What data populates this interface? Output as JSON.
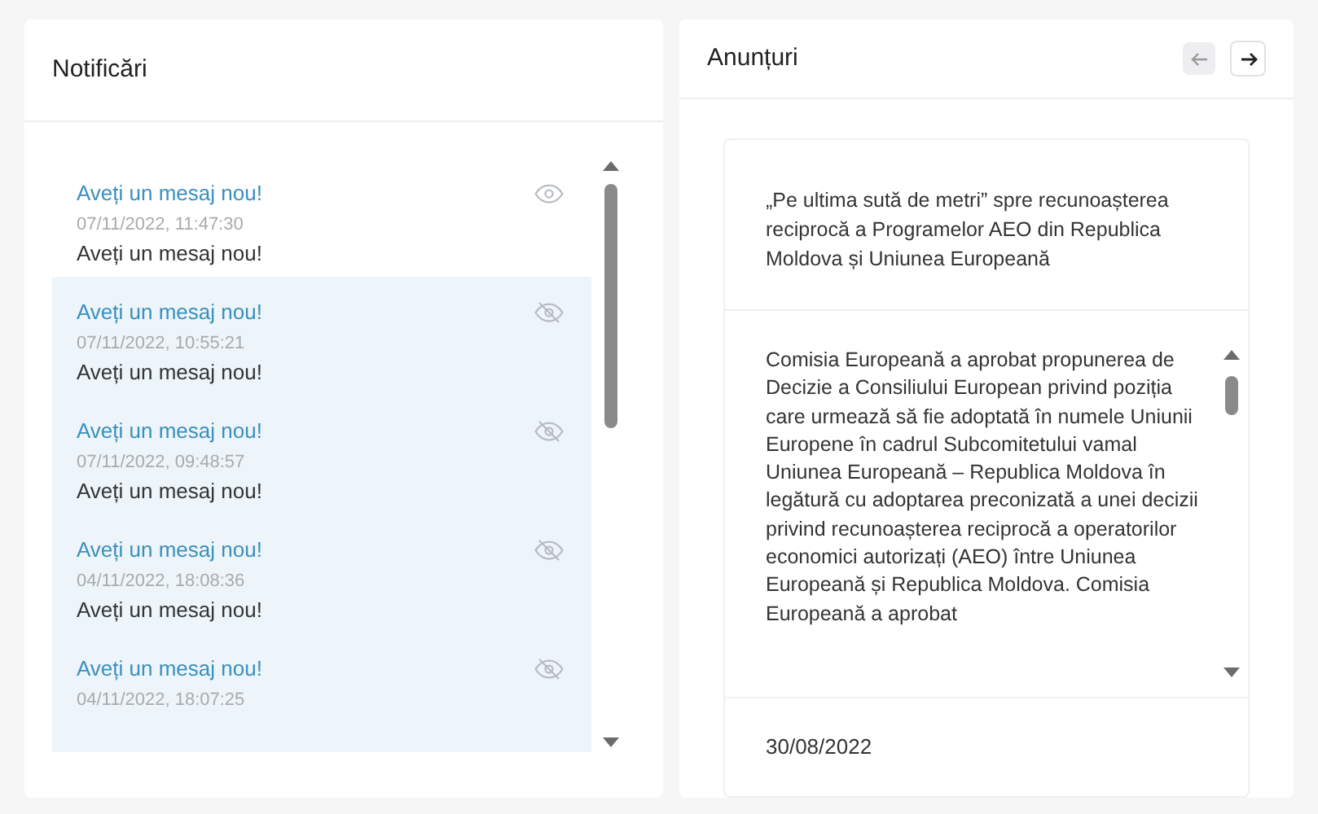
{
  "notifications": {
    "title": "Notificări",
    "items": [
      {
        "title": "Aveți un mesaj nou!",
        "time": "07/11/2022, 11:47:30",
        "body": "Aveți un mesaj nou!",
        "unread": false
      },
      {
        "title": "Aveți un mesaj nou!",
        "time": "07/11/2022, 10:55:21",
        "body": "Aveți un mesaj nou!",
        "unread": true
      },
      {
        "title": "Aveți un mesaj nou!",
        "time": "07/11/2022, 09:48:57",
        "body": "Aveți un mesaj nou!",
        "unread": true
      },
      {
        "title": "Aveți un mesaj nou!",
        "time": "04/11/2022, 18:08:36",
        "body": "Aveți un mesaj nou!",
        "unread": true
      },
      {
        "title": "Aveți un mesaj nou!",
        "time": "04/11/2022, 18:07:25",
        "unread": true
      }
    ]
  },
  "announcements": {
    "title": "Anunțuri",
    "prev_disabled": true,
    "headline": "„Pe ultima sută de metri” spre recunoașterea reciprocă a Programelor AEO din Republica Moldova și Uniunea Europeană",
    "body": "Comisia Europeană a aprobat propunerea de Decizie a Consiliului European privind poziția care urmează să fie adoptată în numele Uniunii Europene în cadrul Subcomitetului vamal Uniunea Europeană – Republica Moldova în legătură cu adoptarea preconizată a unei decizii privind recunoașterea reciprocă a operatorilor economici autorizați (AEO) între Uniunea Europeană și Republica Moldova. Comisia Europeană a aprobat",
    "date": "30/08/2022"
  }
}
